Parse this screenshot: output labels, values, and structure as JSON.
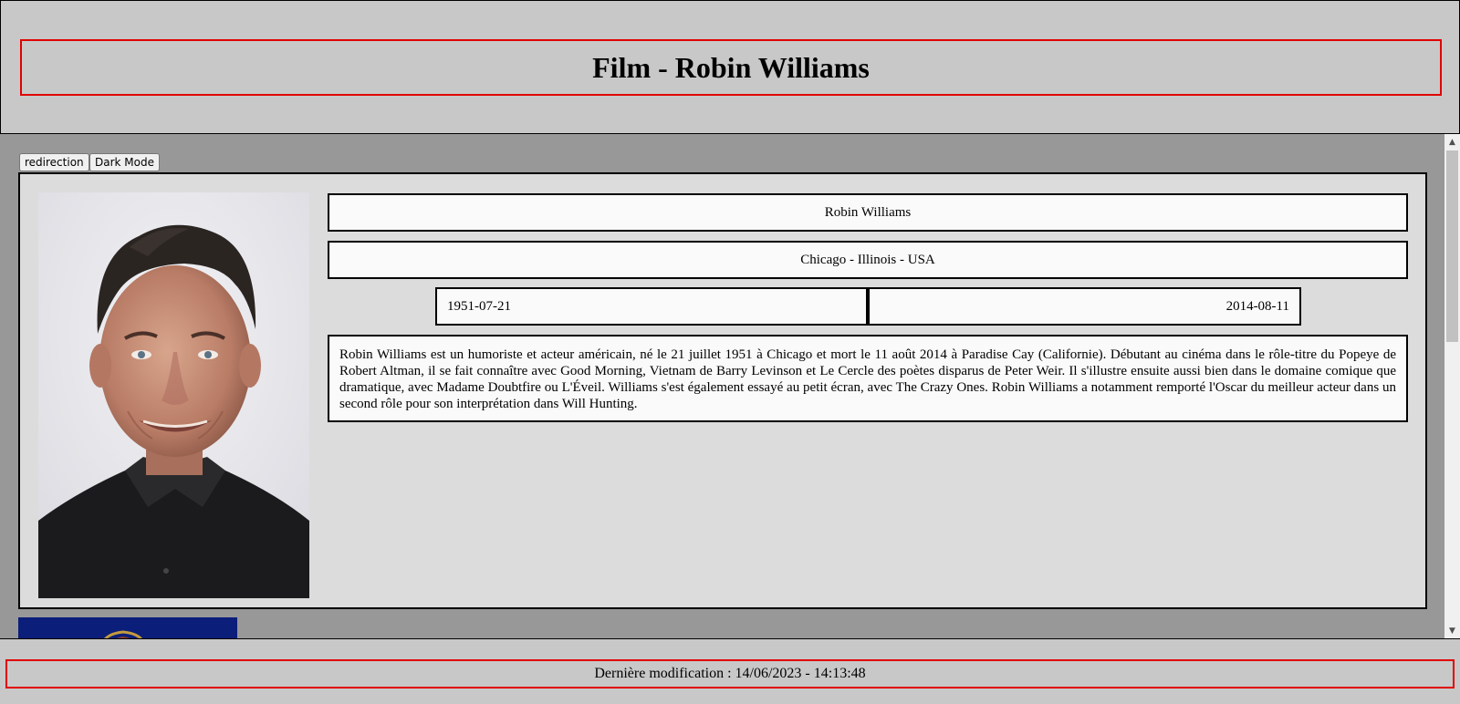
{
  "header": {
    "title": "Film - Robin Williams"
  },
  "toolbar": {
    "redirect_label": "redirection",
    "dark_mode_label": "Dark Mode"
  },
  "person": {
    "name": "Robin Williams",
    "birthplace": "Chicago - Illinois - USA",
    "birth_date": "1951-07-21",
    "death_date": "2014-08-11",
    "bio": "Robin Williams est un humoriste et acteur américain, né le 21 juillet 1951 à Chicago et mort le 11 août 2014 à Paradise Cay (Californie). Débutant au cinéma dans le rôle-titre du Popeye de Robert Altman, il se fait connaître avec Good Morning, Vietnam de Barry Levinson et Le Cercle des poètes disparus de Peter Weir. Il s'illustre ensuite aussi bien dans le domaine comique que dramatique, avec Madame Doubtfire ou L'Éveil. Williams s'est également essayé au petit écran, avec The Crazy Ones. Robin Williams a notamment remporté l'Oscar du meilleur acteur dans un second rôle pour son interprétation dans Will Hunting."
  },
  "footer": {
    "last_modified": "Dernière modification : 14/06/2023 - 14:13:48"
  },
  "colors": {
    "accent_border": "#e00000",
    "panel_bg": "#c8c8c8",
    "main_bg": "#989898",
    "flag_blue": "#0b1e7a"
  },
  "icons": {
    "scroll_up": "scroll-up-arrow-icon",
    "scroll_down": "scroll-down-arrow-icon"
  }
}
